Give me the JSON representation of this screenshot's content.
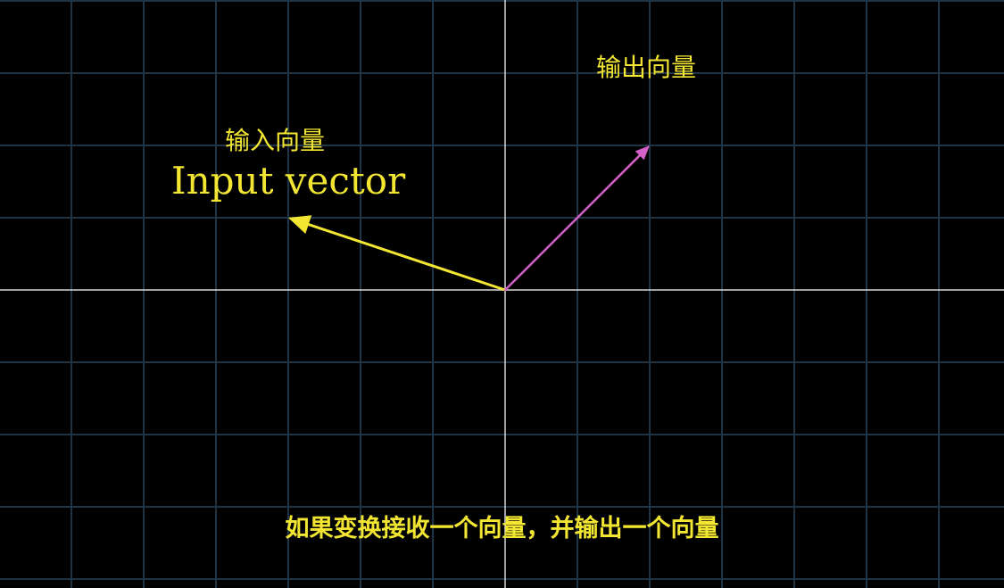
{
  "labels": {
    "input_cn": "输入向量",
    "input_en": "Input vector",
    "output_cn": "输出向量"
  },
  "subtitle": "如果变换接收一个向量，并输出一个向量",
  "vectors": {
    "input": {
      "x": -3,
      "y": 1,
      "color": "#f2e632"
    },
    "output": {
      "x": 2,
      "y": 2,
      "color": "#d35fc7"
    }
  },
  "colors": {
    "background": "#000000",
    "grid_line": "#1f3445",
    "axis_line": "#d8d8d8",
    "text": "#f2e632"
  }
}
